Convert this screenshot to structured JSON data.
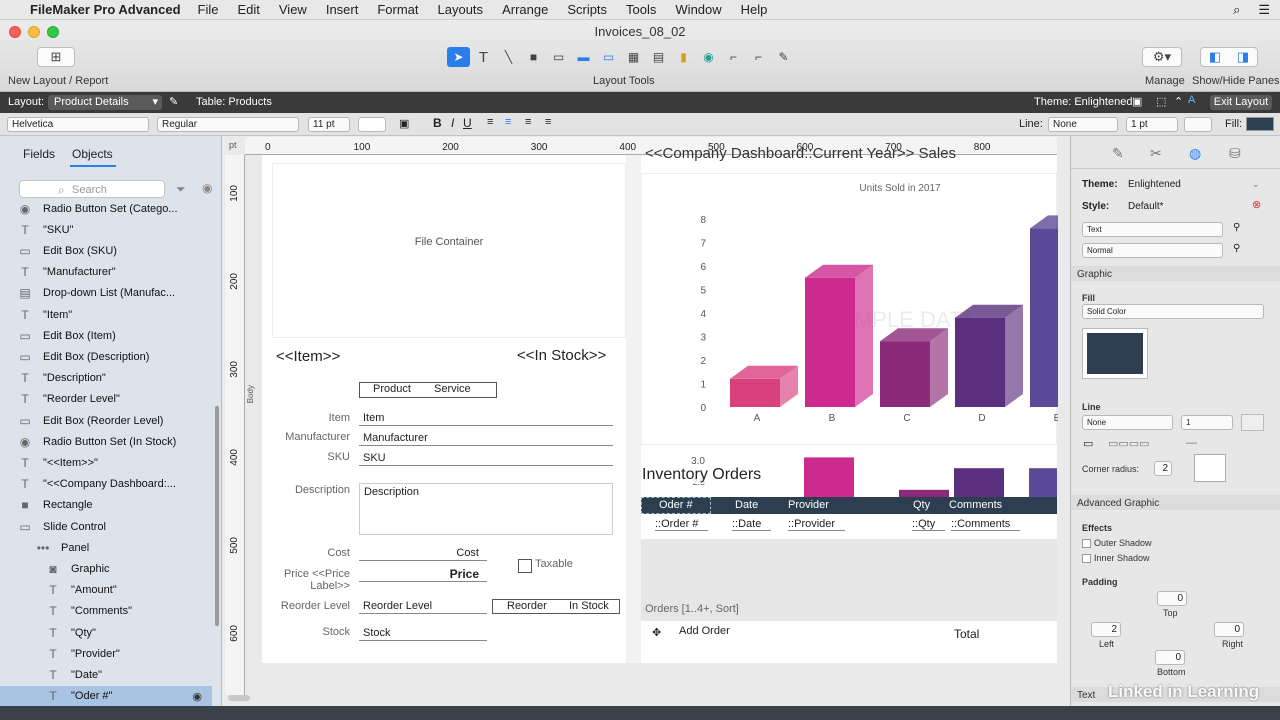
{
  "menubar": {
    "app": "FileMaker Pro Advanced",
    "items": [
      "File",
      "Edit",
      "View",
      "Insert",
      "Format",
      "Layouts",
      "Arrange",
      "Scripts",
      "Tools",
      "Window",
      "Help"
    ]
  },
  "window": {
    "title": "Invoices_08_02"
  },
  "toolbar": {
    "new_layout_label": "New Layout / Report",
    "layout_tools_label": "Layout Tools",
    "manage_label": "Manage",
    "panes_label": "Show/Hide Panes"
  },
  "layoutbar": {
    "layout_label": "Layout:",
    "layout_value": "Product Details",
    "table_label": "Table: Products",
    "theme_label": "Theme: Enlightened",
    "exit_label": "Exit Layout"
  },
  "formatbar": {
    "font": "Helvetica",
    "style": "Regular",
    "size": "11 pt",
    "line_label": "Line:",
    "line_value": "None",
    "line_size": "1 pt",
    "fill_label": "Fill:"
  },
  "leftpanel": {
    "tabs": [
      "Fields",
      "Objects"
    ],
    "search_placeholder": "Search",
    "objects": [
      {
        "icon": "radio-icon",
        "label": "Radio Button Set (Catego..."
      },
      {
        "icon": "text-icon",
        "label": "\"SKU\""
      },
      {
        "icon": "editbox-icon",
        "label": "Edit Box (SKU)"
      },
      {
        "icon": "text-icon",
        "label": "\"Manufacturer\""
      },
      {
        "icon": "dropdown-icon",
        "label": "Drop-down List (Manufac..."
      },
      {
        "icon": "text-icon",
        "label": "\"Item\""
      },
      {
        "icon": "editbox-icon",
        "label": "Edit Box (Item)"
      },
      {
        "icon": "editbox-icon",
        "label": "Edit Box (Description)"
      },
      {
        "icon": "text-icon",
        "label": "\"Description\""
      },
      {
        "icon": "text-icon",
        "label": "\"Reorder Level\""
      },
      {
        "icon": "editbox-icon",
        "label": "Edit Box (Reorder Level)"
      },
      {
        "icon": "radio-icon",
        "label": "Radio Button Set (In Stock)"
      },
      {
        "icon": "text-icon",
        "label": "\"<<Item>>\""
      },
      {
        "icon": "text-icon",
        "label": "\"<<Company Dashboard:..."
      },
      {
        "icon": "rectangle-icon",
        "label": "Rectangle"
      },
      {
        "icon": "slide-control-icon",
        "label": "Slide Control"
      },
      {
        "icon": "panel-icon",
        "label": "Panel"
      },
      {
        "icon": "camera-icon",
        "label": "Graphic"
      },
      {
        "icon": "text-icon",
        "label": "\"Amount\""
      },
      {
        "icon": "text-icon",
        "label": "\"Comments\""
      },
      {
        "icon": "text-icon",
        "label": "\"Qty\""
      },
      {
        "icon": "text-icon",
        "label": "\"Provider\""
      },
      {
        "icon": "text-icon",
        "label": "\"Date\""
      },
      {
        "icon": "text-icon",
        "label": "\"Oder #\""
      }
    ]
  },
  "rulers": {
    "h_ticks": [
      "0",
      "100",
      "200",
      "300",
      "400",
      "500",
      "600",
      "700",
      "800"
    ],
    "v_ticks": [
      "100",
      "200",
      "300",
      "400",
      "500",
      "600"
    ],
    "unit": "pt",
    "part_label": "Body"
  },
  "layout": {
    "file_container": "File Container",
    "item_merge": "<<Item>>",
    "in_stock_merge": "<<In Stock>>",
    "company_merge": "<<Company Dashboard::Current Year>> Sales",
    "product_label": "Product",
    "service_label": "Service",
    "labels": {
      "item": "Item",
      "manufacturer": "Manufacturer",
      "sku": "SKU",
      "description": "Description",
      "cost": "Cost",
      "price": "Price <<Price Label>>",
      "reorder": "Reorder Level",
      "stock": "Stock"
    },
    "fields": {
      "item": "Item",
      "manufacturer": "Manufacturer",
      "sku": "SKU",
      "description": "Description",
      "cost": "Cost",
      "price": "Price",
      "reorder": "Reorder Level",
      "stock": "Stock"
    },
    "taxable": "Taxable",
    "reorder_btn": "Reorder",
    "in_stock_btn": "In Stock",
    "inventory_title": "Inventory Orders",
    "portal_headers": [
      "Oder #",
      "Date",
      "Provider",
      "Qty",
      "Comments"
    ],
    "portal_fields": [
      "::Order #",
      "::Date",
      "::Provider",
      "::Qty",
      "::Comments"
    ],
    "portal_caption": "Orders [1..4+, Sort]",
    "add_order": "Add Order",
    "total": "Total"
  },
  "chart_data": {
    "type": "bar",
    "title": "Units Sold in 2017",
    "categories": [
      "A",
      "B",
      "C",
      "D",
      "E"
    ],
    "values": [
      1.2,
      5.5,
      2.8,
      3.8,
      7.6
    ],
    "ylim": [
      0,
      8
    ],
    "yticks": [
      "0",
      "1",
      "2",
      "3",
      "4",
      "5",
      "6",
      "7",
      "8"
    ],
    "watermark": "SAMPLE DATA",
    "second_tick_a": "3.0",
    "second_tick_b": "2.5",
    "colors": [
      "#d8407e",
      "#cc2a8f",
      "#8c2a7a",
      "#5a2f7e",
      "#5b4a98"
    ]
  },
  "rightpanel": {
    "theme_label": "Theme:",
    "theme_value": "Enlightened",
    "style_label": "Style:",
    "style_value": "Default*",
    "text_dd": "Text",
    "normal_dd": "Normal",
    "graphic_section": "Graphic",
    "fill_label": "Fill",
    "fill_type": "Solid Color",
    "fill_color": "#2c3e4f",
    "line_label": "Line",
    "line_none": "None",
    "line_num": "1",
    "corner_label": "Corner radius:",
    "corner_value": "2",
    "advanced_section": "Advanced Graphic",
    "effects_label": "Effects",
    "outer_shadow": "Outer Shadow",
    "inner_shadow": "Inner Shadow",
    "padding_label": "Padding",
    "pad_top": "0",
    "pad_top_label": "Top",
    "pad_left": "2",
    "pad_left_label": "Left",
    "pad_right": "0",
    "pad_right_label": "Right",
    "pad_bottom": "0",
    "pad_bottom_label": "Bottom",
    "text_section": "Text"
  },
  "watermark": "Linked in Learning"
}
